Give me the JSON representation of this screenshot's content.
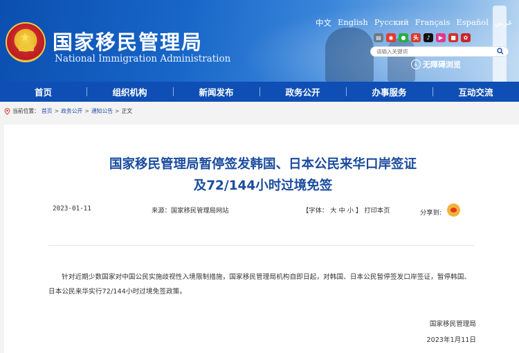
{
  "header": {
    "title": "国家移民管理局",
    "subtitle": "National Immigration Administration",
    "languages": [
      "中文",
      "English",
      "Русский",
      "Français",
      "Español",
      "عربي"
    ],
    "social_icons": [
      "wechat-icon",
      "weibo-icon",
      "chat-icon",
      "toutiao-icon",
      "douyin-icon",
      "kuaishou-icon",
      "app-icon",
      "other-icon"
    ],
    "search": {
      "placeholder": "请输入关键词"
    },
    "accessibility_label": "无障碍浏览"
  },
  "nav": {
    "items": [
      "首页",
      "组织机构",
      "新闻发布",
      "政务公开",
      "办事服务",
      "互动交流"
    ]
  },
  "breadcrumb": {
    "label": "当前位置：",
    "items": [
      "首页",
      "政务公开",
      "通知公告",
      "正文"
    ]
  },
  "article": {
    "title_line1": "国家移民管理局暂停签发韩国、日本公民来华口岸签证",
    "title_line2": "及72/144小时过境免签",
    "date": "2023-01-11",
    "source": "来源：国家移民管理局网站",
    "font_label_open": "【字体：",
    "font_large": "大",
    "font_medium": "中",
    "font_small": "小",
    "font_label_close": "】",
    "print": "打印本页",
    "share_label": "分享到:",
    "body": "针对近期少数国家对中国公民实施歧视性入境限制措施，国家移民管理局机构自即日起，对韩国、日本公民暂停签发口岸签证，暂停韩国、日本公民来华实行72/144小时过境免签政策。",
    "signature": "国家移民管理局",
    "sign_date": "2023年1月11日"
  },
  "colors": {
    "nav_bg": "#0f4fb5",
    "title_color": "#1a4b9e",
    "link_color": "#1d4fa8"
  }
}
